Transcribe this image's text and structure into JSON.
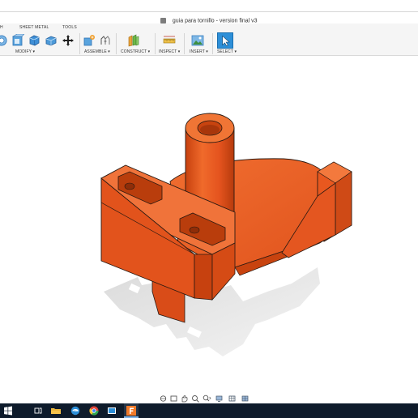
{
  "window": {
    "title": "guia para tornillo - version final v3"
  },
  "ribbon": {
    "tabs": [
      {
        "label": "H"
      },
      {
        "label": "SHEET METAL"
      },
      {
        "label": "TOOLS"
      }
    ],
    "groups": [
      {
        "label": "MODIFY ▾"
      },
      {
        "label": "ASSEMBLE ▾"
      },
      {
        "label": "CONSTRUCT ▾"
      },
      {
        "label": "INSPECT ▾"
      },
      {
        "label": "INSERT ▾"
      },
      {
        "label": "SELECT ▾"
      }
    ]
  },
  "model": {
    "part_color": "#e8521e",
    "shadow_color": "#c9c9c9"
  },
  "colors": {
    "accent": "#2d8fd8",
    "taskbar": "#0e1b2b"
  }
}
